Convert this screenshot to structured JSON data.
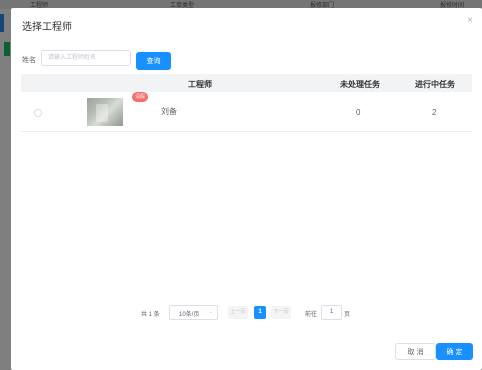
{
  "background": {
    "top_texts": [
      "工程师",
      "工单类型",
      "报修部门",
      "报修时间"
    ]
  },
  "dialog": {
    "title": "选择工程师",
    "close_glyph": "×"
  },
  "search": {
    "label": "姓名",
    "placeholder": "请输入工程师姓名",
    "value": "",
    "button": "查询"
  },
  "table": {
    "columns": [
      "工程师",
      "未处理任务",
      "进行中任务"
    ],
    "rows": [
      {
        "selected": false,
        "badge": "请假",
        "name": "刘备",
        "pending": "0",
        "in_progress": "2"
      }
    ]
  },
  "pagination": {
    "total": "共 1 条",
    "page_size": "10条/页",
    "prev": "上一页",
    "current_page": "1",
    "next": "下一页",
    "goto": "前往",
    "goto_value": "1",
    "unit": "页"
  },
  "footer": {
    "cancel": "取 消",
    "confirm": "确 定"
  },
  "colors": {
    "primary": "#1890ff",
    "badge": "#f56c6c"
  }
}
